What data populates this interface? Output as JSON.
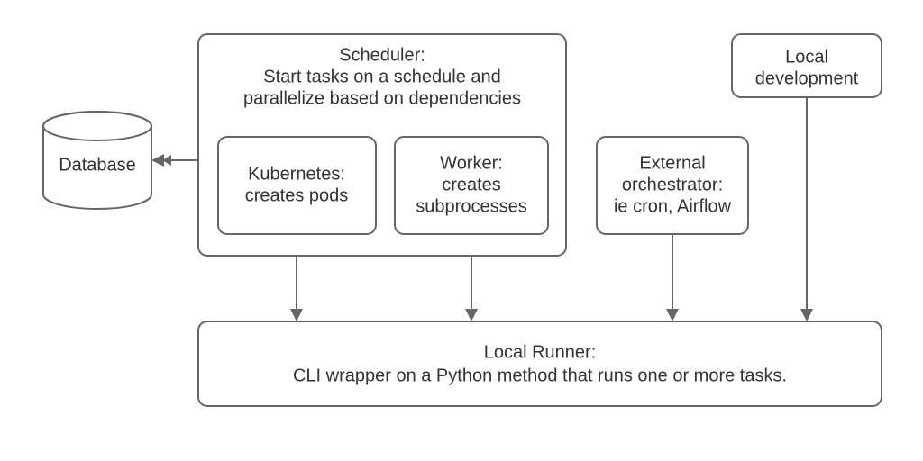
{
  "database": {
    "label": "Database"
  },
  "scheduler": {
    "title": "Scheduler:",
    "desc1": "Start tasks on a schedule and",
    "desc2": "parallelize based on dependencies"
  },
  "kubernetes": {
    "line1": "Kubernetes:",
    "line2": "creates pods"
  },
  "worker": {
    "line1": "Worker:",
    "line2": "creates",
    "line3": "subprocesses"
  },
  "external": {
    "line1": "External",
    "line2": "orchestrator:",
    "line3": "ie cron, Airflow"
  },
  "localdev": {
    "line1": "Local",
    "line2": "development"
  },
  "localrunner": {
    "line1": "Local Runner:",
    "line2": "CLI wrapper on a Python method that runs one or more tasks."
  }
}
